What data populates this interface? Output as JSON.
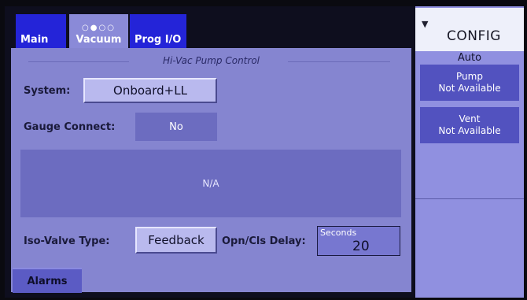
{
  "tabs": [
    {
      "label": "Main"
    },
    {
      "label": "Vacuum",
      "dots": "○●○○"
    },
    {
      "label": "Prog I/O"
    }
  ],
  "section": {
    "title": "Hi-Vac Pump Control"
  },
  "system": {
    "label": "System:",
    "value": "Onboard+LL"
  },
  "gauge": {
    "label": "Gauge Connect:",
    "value": "No"
  },
  "info_area": {
    "text": "N/A"
  },
  "iso_valve": {
    "label": "Iso-Valve Type:",
    "value": "Feedback"
  },
  "delay": {
    "label": "Opn/Cls Delay:",
    "unit": "Seconds",
    "value": "20"
  },
  "alarms": {
    "label": "Alarms"
  },
  "config": {
    "title": "CONFIG",
    "arrow": "▼",
    "mode": "Auto",
    "pump": {
      "title": "Pump",
      "status": "Not Available"
    },
    "vent": {
      "title": "Vent",
      "status": "Not Available"
    }
  },
  "colors": {
    "tab_active": "#8a8ad8",
    "tab_inactive": "#2424d8",
    "panel": "#8585d0",
    "status_button": "#5252bf"
  }
}
